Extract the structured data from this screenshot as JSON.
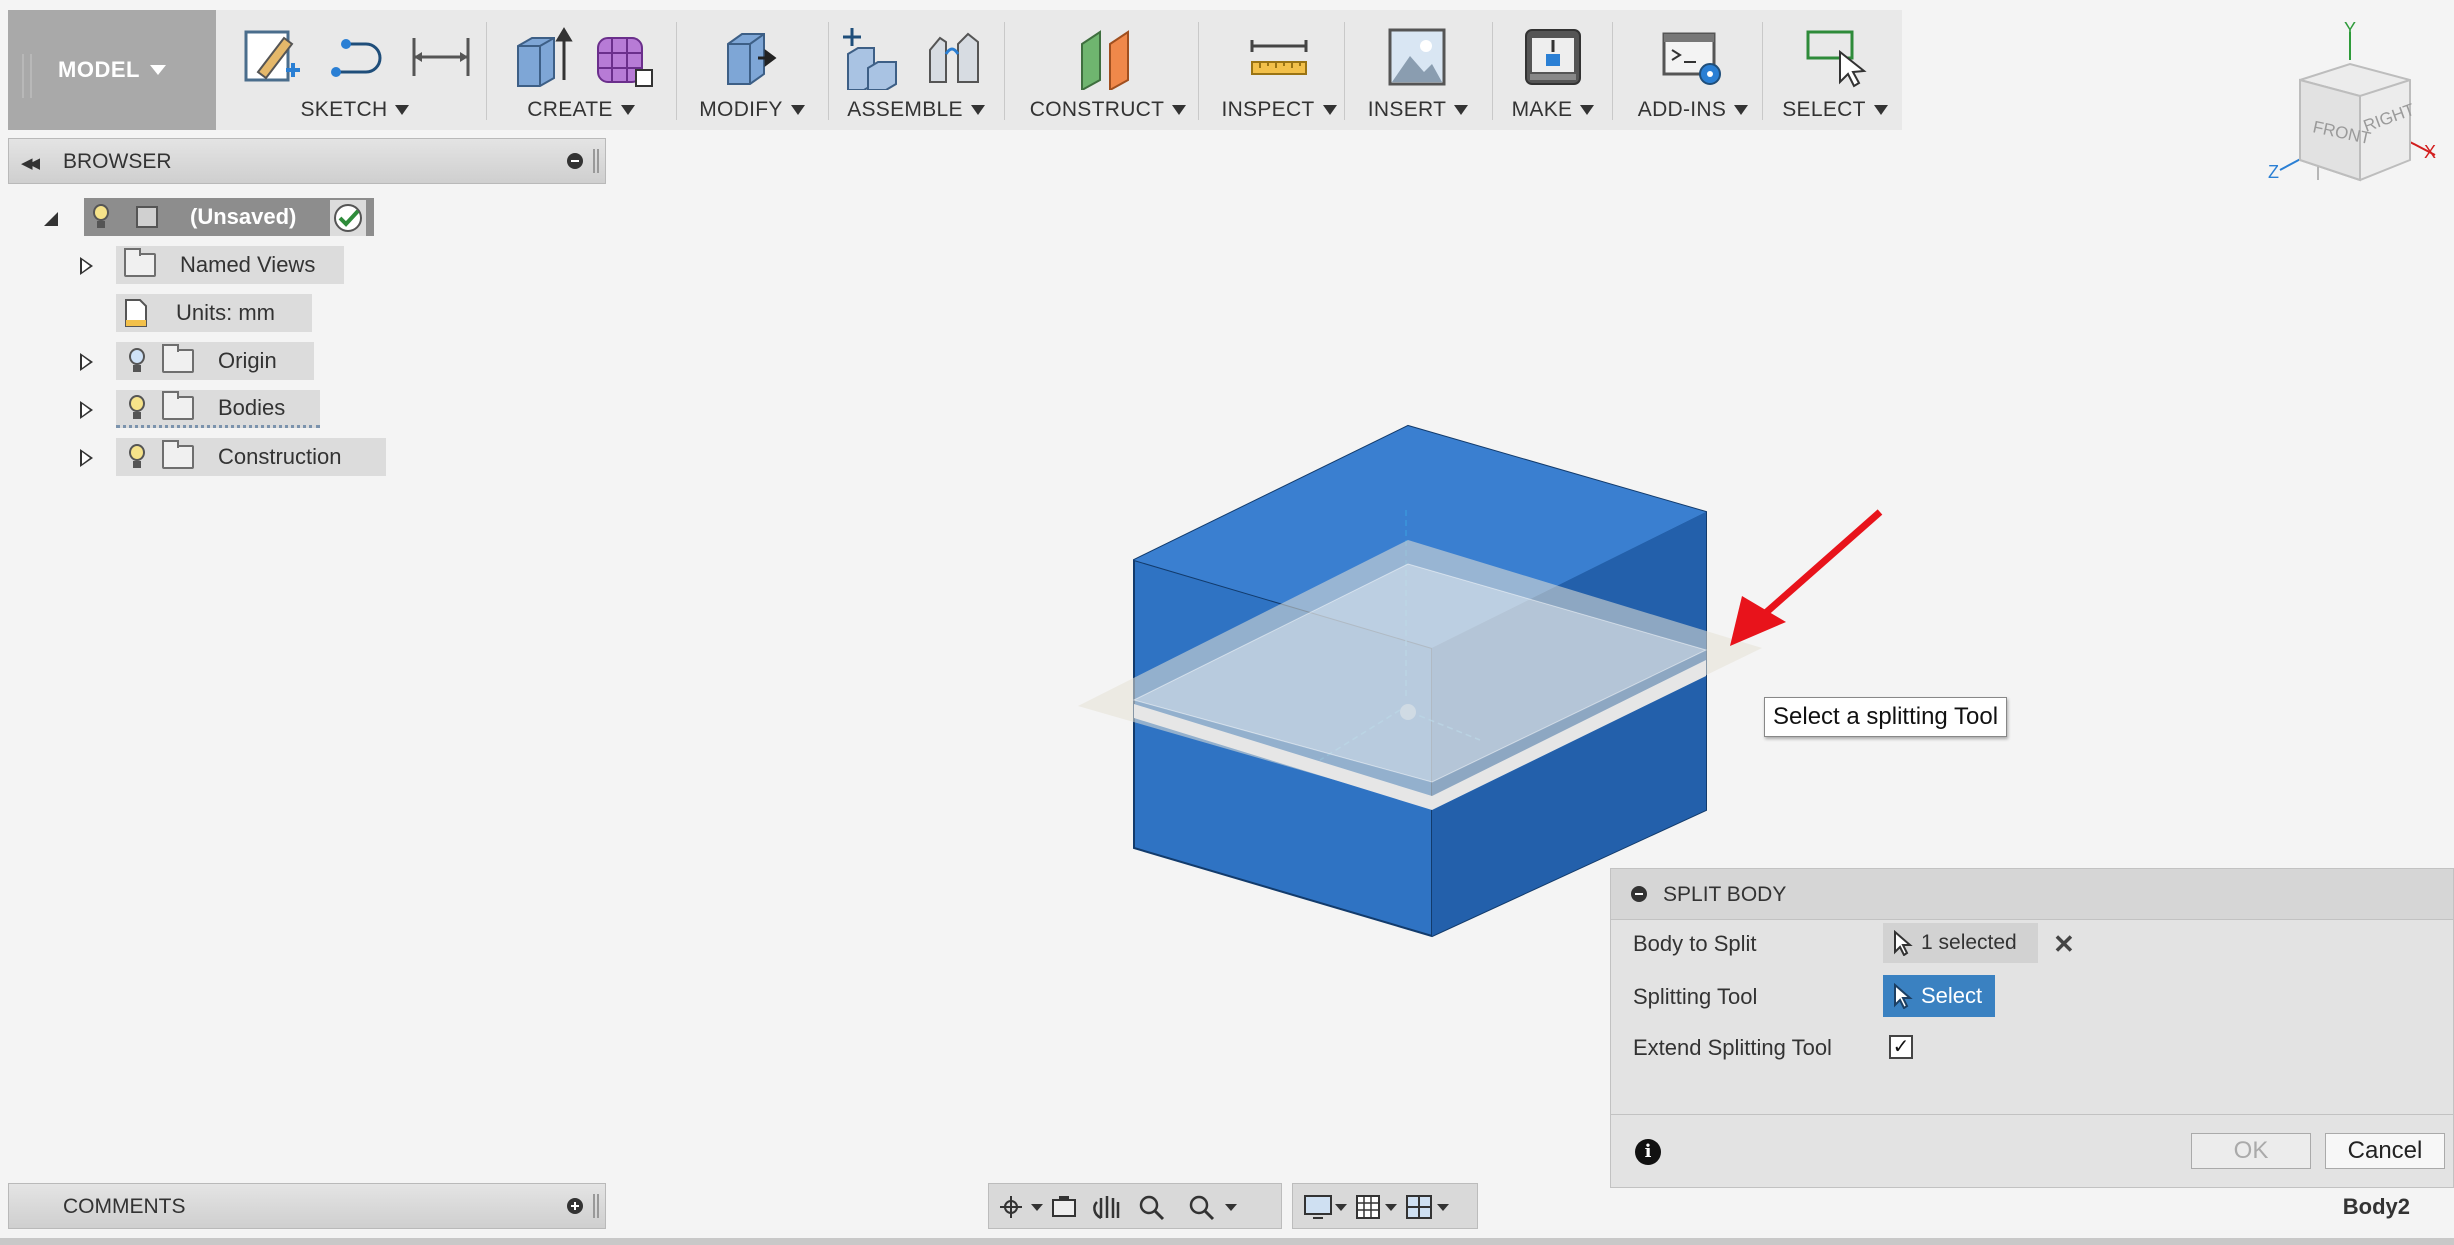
{
  "toolbar": {
    "workspace": "MODEL",
    "groups": [
      {
        "label": "SKETCH"
      },
      {
        "label": "CREATE"
      },
      {
        "label": "MODIFY"
      },
      {
        "label": "ASSEMBLE"
      },
      {
        "label": "CONSTRUCT"
      },
      {
        "label": "INSPECT"
      },
      {
        "label": "INSERT"
      },
      {
        "label": "MAKE"
      },
      {
        "label": "ADD-INS"
      },
      {
        "label": "SELECT"
      }
    ]
  },
  "browser": {
    "title": "BROWSER",
    "root": {
      "label": "(Unsaved)"
    },
    "items": [
      {
        "label": "Named Views",
        "icon": "folder-icon"
      },
      {
        "label": "Units: mm",
        "icon": "units-doc-icon"
      },
      {
        "label": "Origin",
        "icon": "folder-icon"
      },
      {
        "label": "Bodies",
        "icon": "folder-icon"
      },
      {
        "label": "Construction",
        "icon": "folder-icon"
      }
    ]
  },
  "viewcube": {
    "front": "FRONT",
    "right": "RIGHT",
    "axis_x": "X",
    "axis_y": "Y",
    "axis_z": "Z"
  },
  "viewport": {
    "tooltip": "Select a splitting Tool",
    "body_color": "#2f73c3",
    "arrow_color": "#e8131b"
  },
  "split_dialog": {
    "title": "SPLIT BODY",
    "rows": [
      {
        "label": "Body to Split",
        "value": "1 selected"
      },
      {
        "label": "Splitting Tool",
        "value": "Select"
      },
      {
        "label": "Extend Splitting Tool",
        "checked": true
      }
    ],
    "ok": "OK",
    "cancel": "Cancel"
  },
  "comments": {
    "title": "COMMENTS"
  },
  "status": {
    "active_body": "Body2"
  }
}
